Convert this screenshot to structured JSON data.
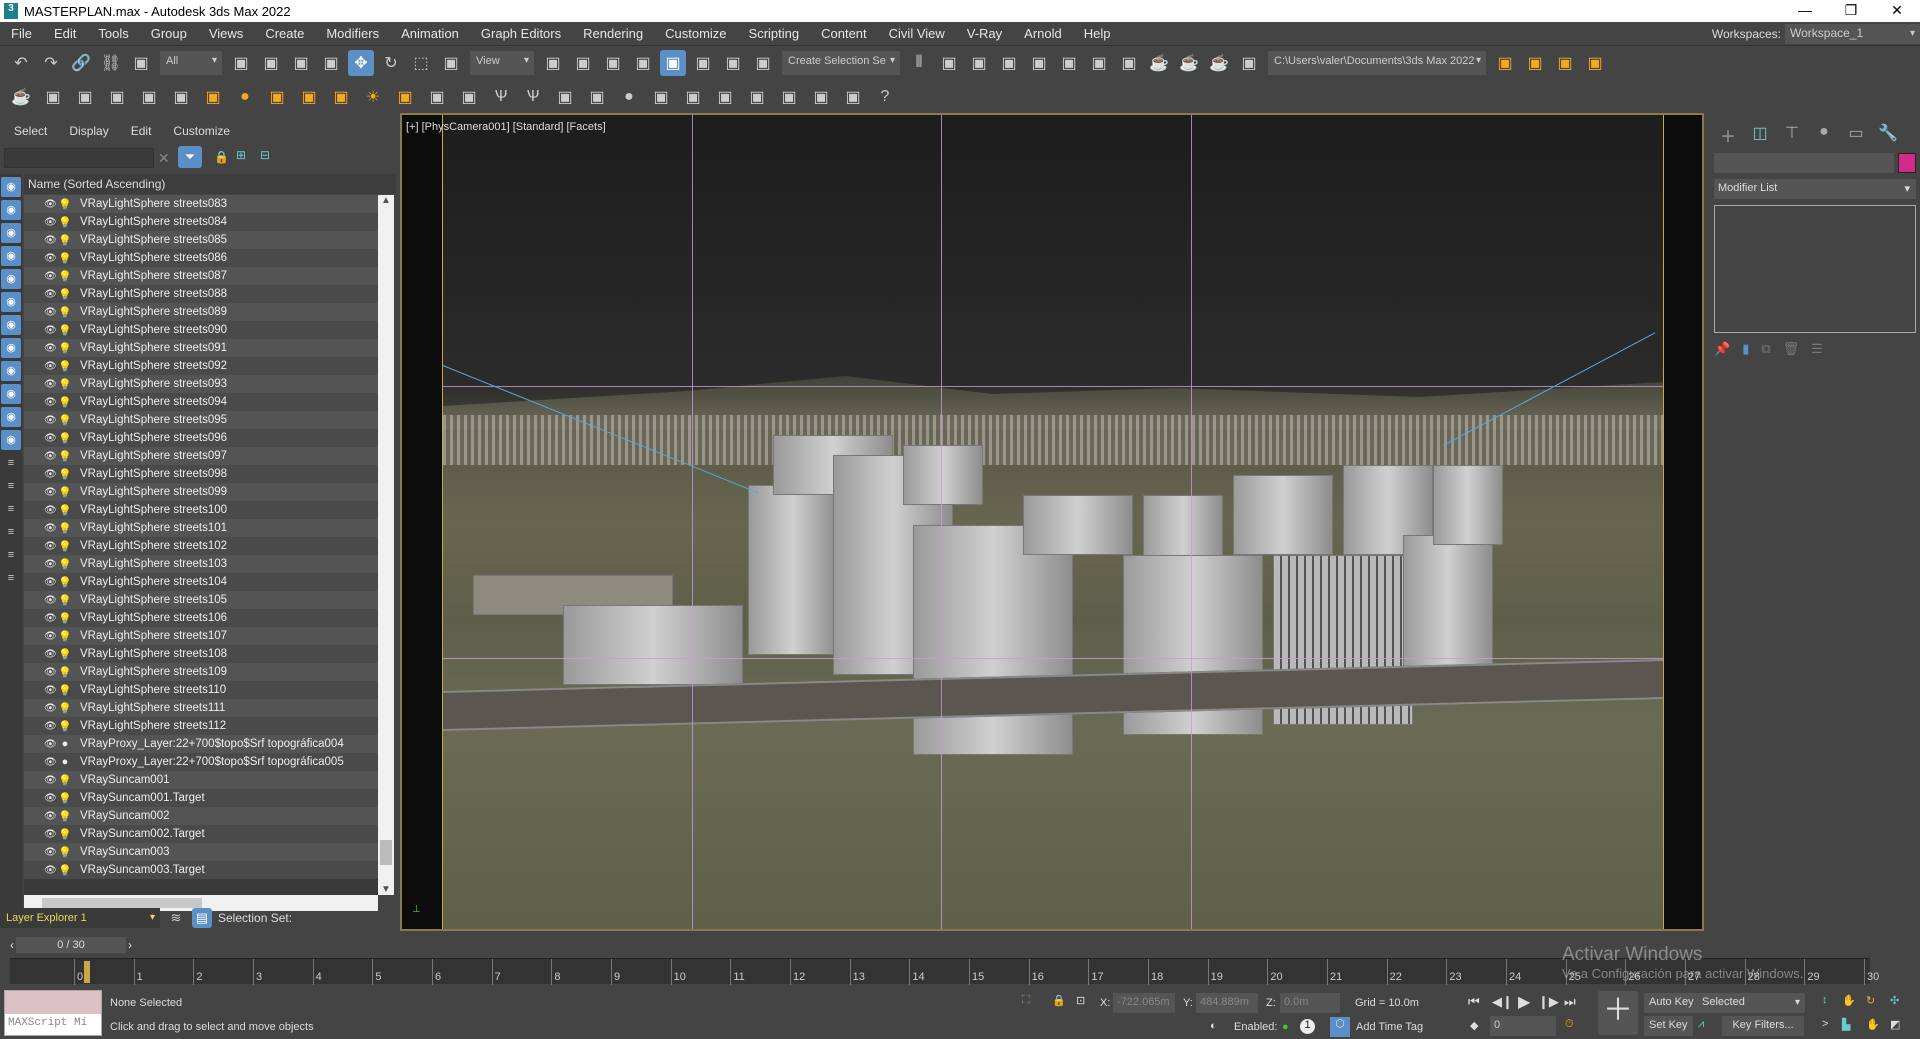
{
  "window": {
    "title": "MASTERPLAN.max - Autodesk 3ds Max 2022",
    "app_icon": "3ds-max-logo"
  },
  "menu": [
    "File",
    "Edit",
    "Tools",
    "Group",
    "Views",
    "Create",
    "Modifiers",
    "Animation",
    "Graph Editors",
    "Rendering",
    "Customize",
    "Scripting",
    "Content",
    "Civil View",
    "V-Ray",
    "Arnold",
    "Help"
  ],
  "workspaces": {
    "label": "Workspaces:",
    "value": "Workspace_1"
  },
  "toolbar1": {
    "filter": "All",
    "refcoord": "View",
    "selset": "Create Selection Se",
    "project_path": "C:\\Users\\valer\\Documents\\3ds Max 2022",
    "icons_a": [
      "undo-icon",
      "redo-icon",
      "link-icon",
      "unlink-icon",
      "bind-spacewarp-icon"
    ],
    "icons_b": [
      "select-object-icon",
      "select-by-name-icon",
      "rect-selection-icon",
      "window-crossing-icon",
      "select-move-icon",
      "select-rotate-icon",
      "select-scale-icon",
      "placement-icon"
    ],
    "icons_c": [
      "pivot-icon",
      "snap-move-icon",
      "keyboard-shortcut-icon",
      "snaps-3d-icon",
      "angle-snap-icon",
      "percent-snap-icon",
      "spinner-snap-icon",
      "named-sets-icon"
    ],
    "icons_d": [
      "mirror-icon",
      "align-icon",
      "scene-explorer-icon",
      "layer-explorer-icon",
      "ribbon-icon",
      "curve-editor-icon",
      "schematic-icon",
      "material-editor-icon",
      "render-setup-icon",
      "render-frame-icon",
      "render-icon",
      "active-shade-icon"
    ],
    "icons_e": [
      "project-icon",
      "project-folder-icon",
      "project-tree-icon",
      "project-structure-icon"
    ]
  },
  "toolbar2": {
    "icons": [
      "teapot-icon",
      "vray-dome-icon",
      "vray-frame-buffer-icon",
      "vray-proxy-icon",
      "vray-camera-icon",
      "vray-physical-camera-icon",
      "vray-plane-light-icon",
      "vray-sphere-light-icon",
      "vray-disc-light-icon",
      "vray-mesh-light-icon",
      "vray-ies-icon",
      "vray-sun-icon",
      "vray-ambient-icon",
      "vray-box-icon",
      "vray-clipper-icon",
      "vray-fur-icon",
      "vray-grass-icon",
      "vray-decal-icon",
      "vray-fire-icon",
      "vray-sphere-icon",
      "vray-scatter-icon",
      "vray-material-icon",
      "vray-lighting-icon",
      "vray-chaos-icon",
      "vray-vantage-icon",
      "vray-forest-icon",
      "vray-notes-icon",
      "help-icon"
    ]
  },
  "scene_explorer": {
    "menu": [
      "Select",
      "Display",
      "Edit",
      "Customize"
    ],
    "search_placeholder": "",
    "column_header": "Name (Sorted Ascending)",
    "left_icons": [
      "geometry-icon",
      "shapes-icon",
      "lights-icon",
      "cameras-icon",
      "helpers-icon",
      "spacewarps-icon",
      "groups-icon",
      "xrefs-icon",
      "bones-icon",
      "containers-icon",
      "frozen-icon",
      "hidden-icon",
      "list-icon",
      "all-icon",
      "invert-icon",
      "filter-clear-icon",
      "filter-icon",
      "container-icon"
    ],
    "items": [
      "VRayLightSphere streets083",
      "VRayLightSphere streets084",
      "VRayLightSphere streets085",
      "VRayLightSphere streets086",
      "VRayLightSphere streets087",
      "VRayLightSphere streets088",
      "VRayLightSphere streets089",
      "VRayLightSphere streets090",
      "VRayLightSphere streets091",
      "VRayLightSphere streets092",
      "VRayLightSphere streets093",
      "VRayLightSphere streets094",
      "VRayLightSphere streets095",
      "VRayLightSphere streets096",
      "VRayLightSphere streets097",
      "VRayLightSphere streets098",
      "VRayLightSphere streets099",
      "VRayLightSphere streets100",
      "VRayLightSphere streets101",
      "VRayLightSphere streets102",
      "VRayLightSphere streets103",
      "VRayLightSphere streets104",
      "VRayLightSphere streets105",
      "VRayLightSphere streets106",
      "VRayLightSphere streets107",
      "VRayLightSphere streets108",
      "VRayLightSphere streets109",
      "VRayLightSphere streets110",
      "VRayLightSphere streets111",
      "VRayLightSphere streets112",
      "VRayProxy_Layer:22+700$topo$Srf topográfica004",
      "VRayProxy_Layer:22+700$topo$Srf topográfica005",
      "VRaySuncam001",
      "VRaySuncam001.Target",
      "VRaySuncam002",
      "VRaySuncam002.Target",
      "VRaySuncam003",
      "VRaySuncam003.Target"
    ],
    "layer_explorer": "Layer Explorer 1",
    "selection_set_label": "Selection Set:"
  },
  "viewport": {
    "label": "[+] [PhysCamera001] [Standard] [Facets]"
  },
  "command_panel": {
    "modifier_list": "Modifier List",
    "object_color": "#d12a8b"
  },
  "timeline": {
    "position": "0 / 30",
    "ticks": [
      0,
      1,
      2,
      3,
      4,
      5,
      6,
      7,
      8,
      9,
      10,
      11,
      12,
      13,
      14,
      15,
      16,
      17,
      18,
      19,
      20,
      21,
      22,
      23,
      24,
      25,
      26,
      27,
      28,
      29,
      30
    ]
  },
  "status": {
    "maxscript": "MAXScript Mi",
    "selection": "None Selected",
    "prompt": "Click and drag to select and move objects",
    "x_label": "X:",
    "x": "-722.065m",
    "y_label": "Y:",
    "y": "484.889m",
    "z_label": "Z:",
    "z": "0.0m",
    "grid": "Grid = 10.0m",
    "enabled_label": "Enabled:",
    "add_time_tag": "Add Time Tag",
    "auto_key": "Auto Key",
    "set_key": "Set Key",
    "key_mode": "Selected",
    "key_filters": "Key Filters...",
    "frame": "0"
  },
  "watermark": {
    "line1": "Activar Windows",
    "line2": "Ve a Configuración para activar Windows."
  }
}
